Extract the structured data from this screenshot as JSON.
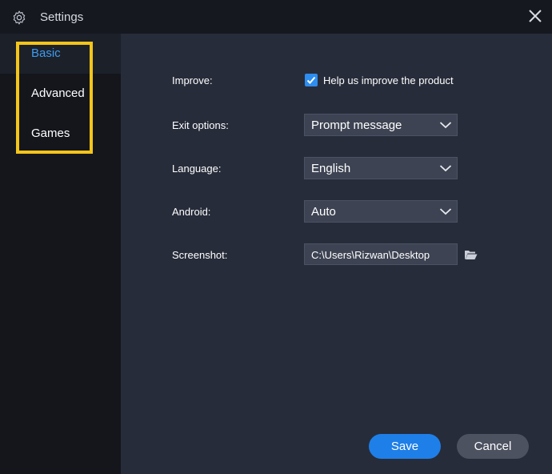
{
  "window": {
    "title": "Settings"
  },
  "sidebar": {
    "items": [
      {
        "label": "Basic",
        "active": true
      },
      {
        "label": "Advanced",
        "active": false
      },
      {
        "label": "Games",
        "active": false
      }
    ],
    "highlight_color": "#f4c51a"
  },
  "form": {
    "improve": {
      "label": "Improve:",
      "checkbox_label": "Help us improve the product",
      "checked": true
    },
    "exit_options": {
      "label": "Exit options:",
      "value": "Prompt message"
    },
    "language": {
      "label": "Language:",
      "value": "English"
    },
    "android": {
      "label": "Android:",
      "value": "Auto"
    },
    "screenshot": {
      "label": "Screenshot:",
      "path": "C:\\Users\\Rizwan\\Desktop"
    }
  },
  "buttons": {
    "save": "Save",
    "cancel": "Cancel"
  },
  "colors": {
    "accent": "#1f7fe8",
    "active_nav": "#3d9cf0",
    "background": "#272c3a"
  }
}
